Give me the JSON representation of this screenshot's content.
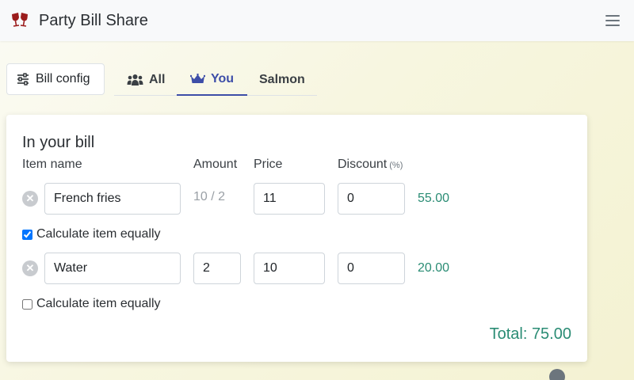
{
  "app": {
    "title": "Party Bill Share",
    "logo_icon": "wine-glasses-icon",
    "menu_icon": "hamburger-icon"
  },
  "toolbar": {
    "config_label": "Bill config",
    "config_icon": "sliders-icon",
    "tabs": [
      {
        "label": "All",
        "icon": "group-icon",
        "active": false
      },
      {
        "label": "You",
        "icon": "crown-icon",
        "active": true
      },
      {
        "label": "Salmon",
        "active": false
      }
    ]
  },
  "bill": {
    "title": "In your bill",
    "headers": {
      "item_name": "Item name",
      "amount": "Amount",
      "price": "Price",
      "discount": "Discount",
      "discount_unit": "(%)"
    },
    "items": [
      {
        "name": "French fries",
        "amount": "",
        "amount_text": "10 / 2",
        "price": "11",
        "discount": "0",
        "line_total": "55.00",
        "equal_label": "Calculate item equally",
        "equal_checked": true
      },
      {
        "name": "Water",
        "amount": "2",
        "amount_text": "",
        "price": "10",
        "discount": "0",
        "line_total": "20.00",
        "equal_label": "Calculate item equally",
        "equal_checked": false
      }
    ],
    "total_label": "Total: 75.00"
  },
  "colors": {
    "accent": "#3d4ea8",
    "money": "#2a8c74",
    "logo": "#9b1c1c"
  }
}
